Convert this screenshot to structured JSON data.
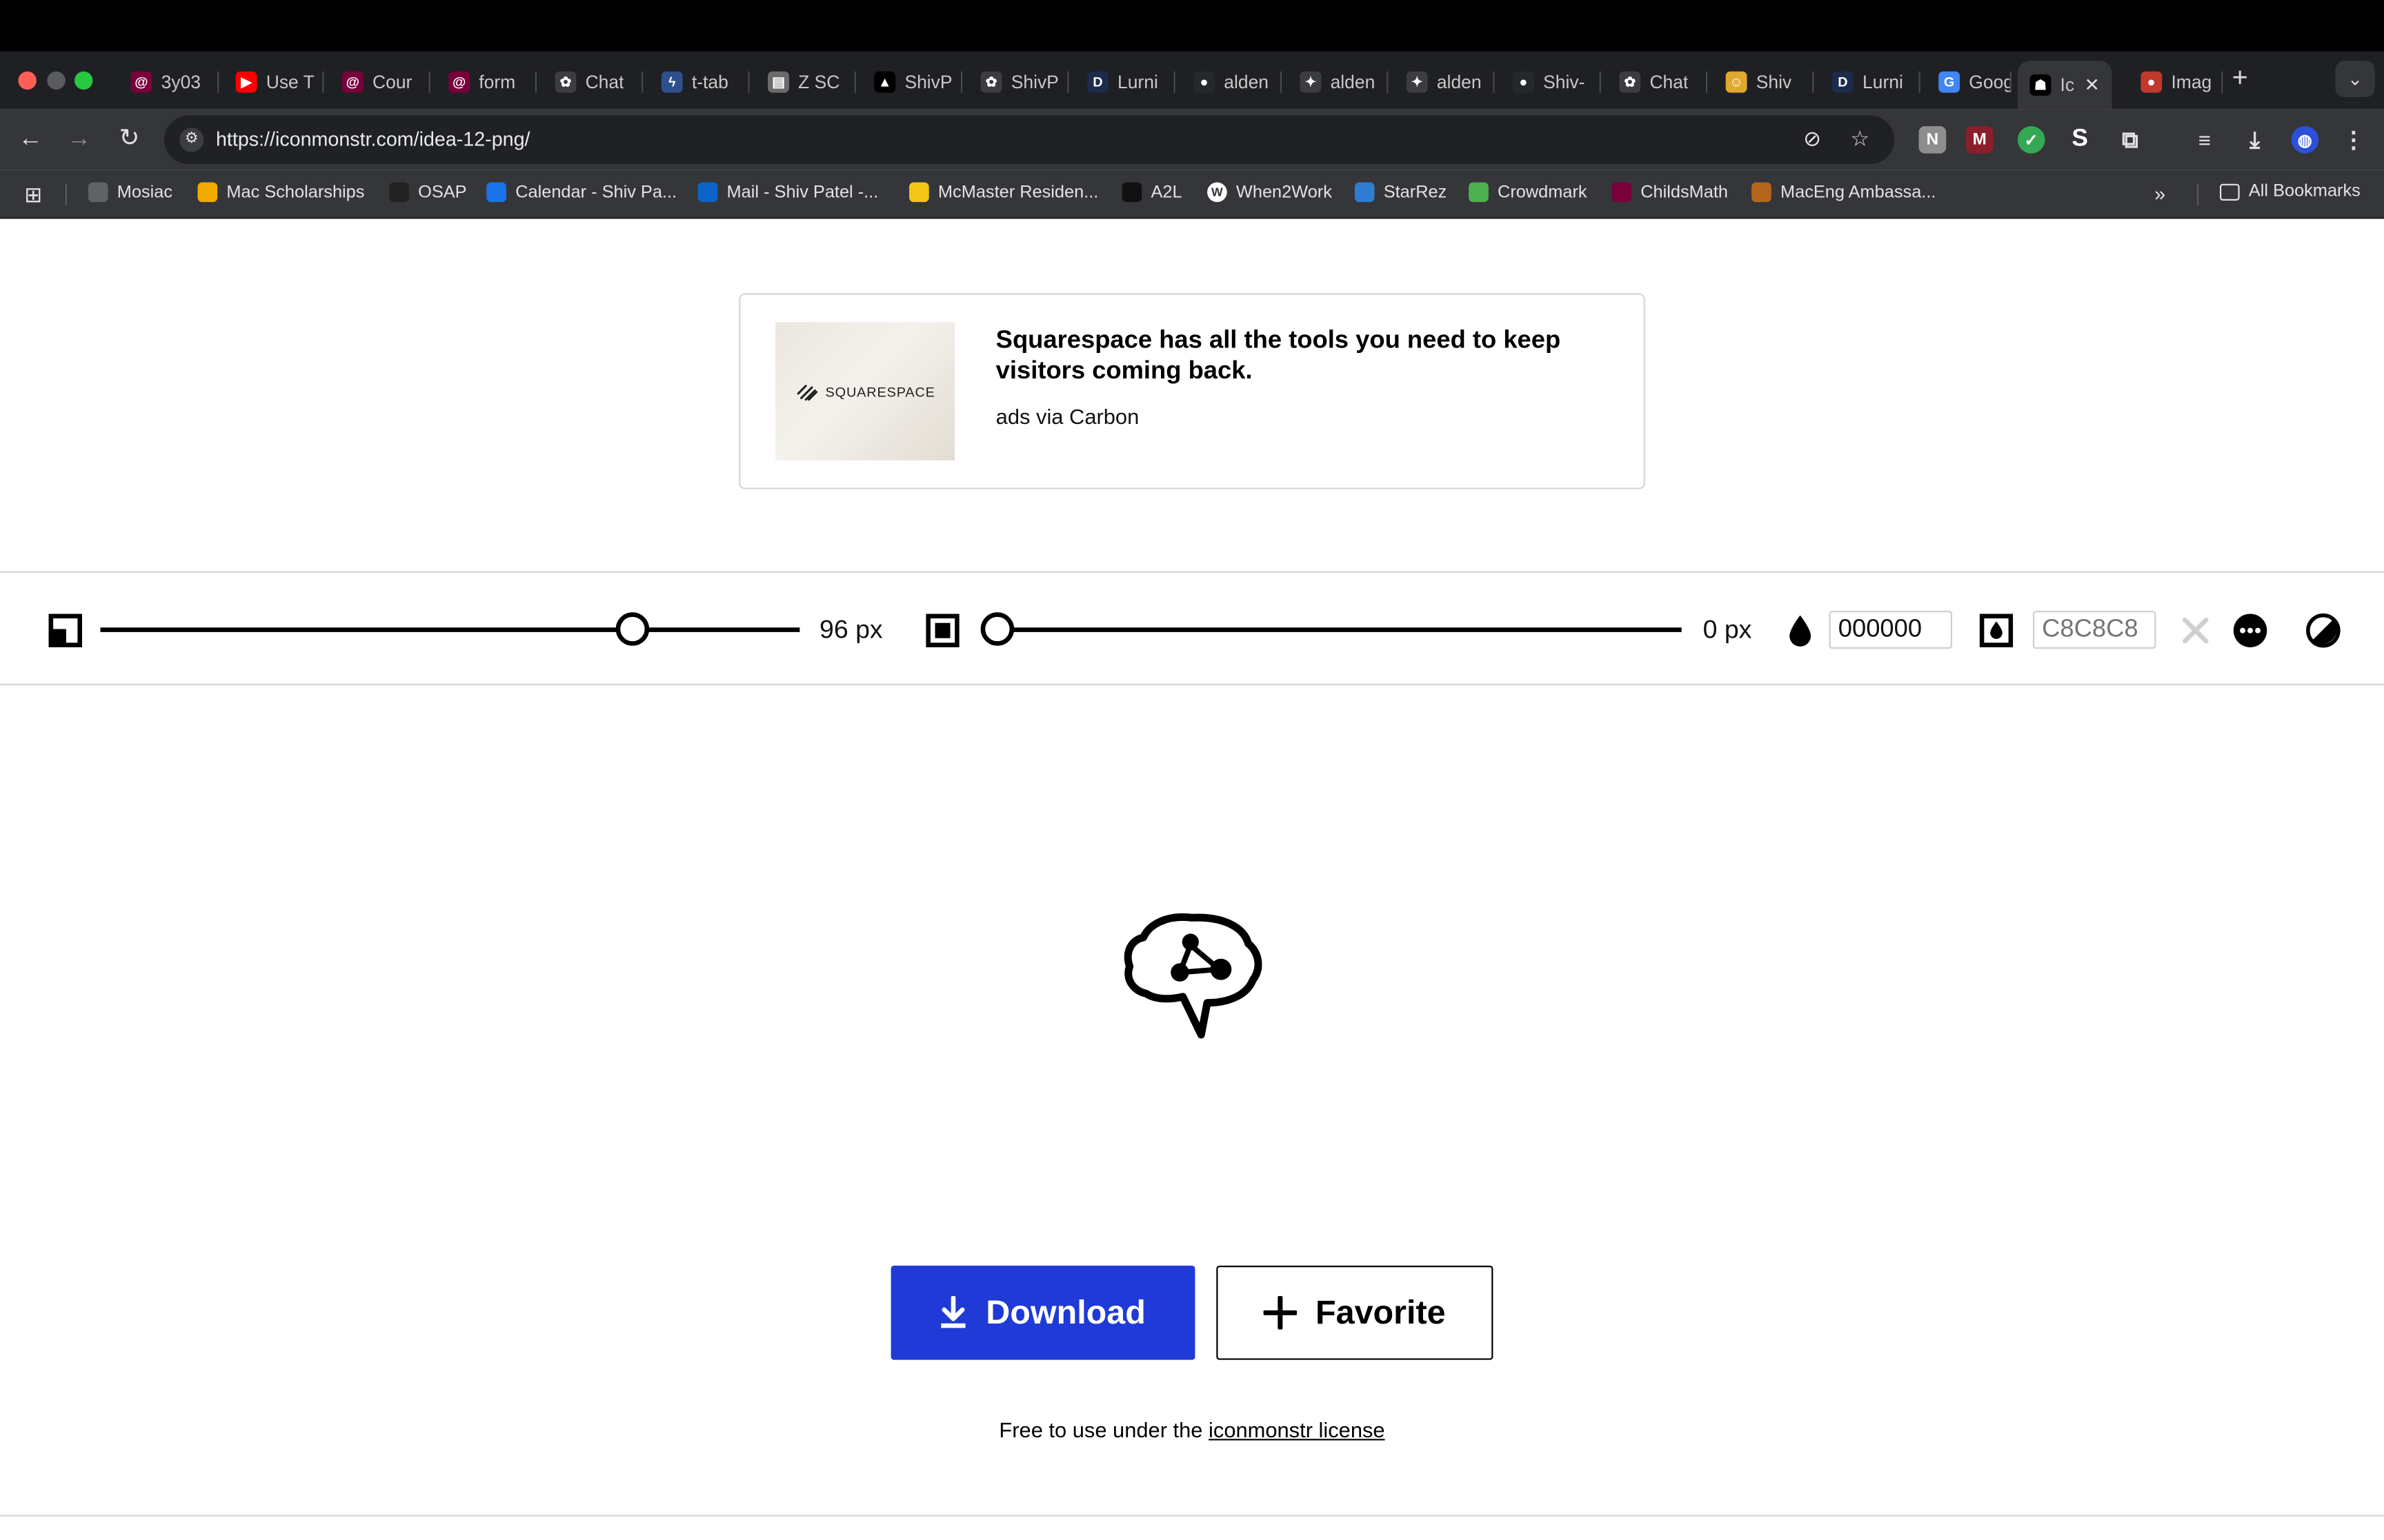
{
  "browser": {
    "tabs": [
      {
        "label": "3y03",
        "favicon": "mcmaster-icon",
        "color": "#7a003c",
        "glyph": "@"
      },
      {
        "label": "Use T",
        "favicon": "youtube-icon",
        "color": "#ff0000",
        "glyph": "▶"
      },
      {
        "label": "Cour",
        "favicon": "mcmaster-icon",
        "color": "#7a003c",
        "glyph": "@"
      },
      {
        "label": "form",
        "favicon": "mcmaster-icon",
        "color": "#7a003c",
        "glyph": "@"
      },
      {
        "label": "Chat",
        "favicon": "openai-icon",
        "color": "#3c3d41",
        "glyph": "✿"
      },
      {
        "label": "t-tab",
        "favicon": "pytorch-icon",
        "color": "#2d4f8c",
        "glyph": "ϟ"
      },
      {
        "label": "Z SC",
        "favicon": "document-icon",
        "color": "#6b6b6b",
        "glyph": "▤"
      },
      {
        "label": "ShivP",
        "favicon": "vercel-icon",
        "color": "#000000",
        "glyph": "▲"
      },
      {
        "label": "ShivP",
        "favicon": "openai-icon",
        "color": "#3c3d41",
        "glyph": "✿"
      },
      {
        "label": "Lurni",
        "favicon": "d-icon",
        "color": "#1c2b4a",
        "glyph": "D"
      },
      {
        "label": "alden",
        "favicon": "github-icon",
        "color": "#24292e",
        "glyph": "●"
      },
      {
        "label": "alden",
        "favicon": "sparkle-icon",
        "color": "#3c3d41",
        "glyph": "✦"
      },
      {
        "label": "alden",
        "favicon": "sparkle-icon",
        "color": "#3c3d41",
        "glyph": "✦"
      },
      {
        "label": "Shiv-",
        "favicon": "github-icon",
        "color": "#24292e",
        "glyph": "●"
      },
      {
        "label": "Chat",
        "favicon": "openai-icon",
        "color": "#3c3d41",
        "glyph": "✿"
      },
      {
        "label": "Shiv",
        "favicon": "emoji-icon",
        "color": "#e0a82e",
        "glyph": "☺"
      },
      {
        "label": "Lurni",
        "favicon": "d-icon",
        "color": "#1c2b4a",
        "glyph": "D"
      },
      {
        "label": "Goog",
        "favicon": "google-icon",
        "color": "#4285f4",
        "glyph": "G"
      },
      {
        "label": "Ic",
        "favicon": "iconmonstr-icon",
        "color": "#000000",
        "glyph": "☗"
      },
      {
        "label": "Imag",
        "favicon": "avatar-icon",
        "color": "#c0392b",
        "glyph": "●"
      }
    ],
    "url": "https://iconmonstr.com/idea-12-png/",
    "bookmarks": [
      {
        "label": "Mosiac",
        "icon": "globe-icon",
        "color": "#5f6368"
      },
      {
        "label": "Mac Scholarships",
        "icon": "triangle-icon",
        "color": "#f2a900"
      },
      {
        "label": "OSAP",
        "icon": "shield-icon",
        "color": "#222222"
      },
      {
        "label": "Calendar - Shiv Pa...",
        "icon": "calendar-icon",
        "color": "#1a73e8"
      },
      {
        "label": "Mail - Shiv Patel -...",
        "icon": "outlook-icon",
        "color": "#0a64c8"
      },
      {
        "label": "McMaster Residen...",
        "icon": "star-icon",
        "color": "#f5c518"
      },
      {
        "label": "A2L",
        "icon": "d2l-icon",
        "color": "#111111"
      },
      {
        "label": "When2Work",
        "icon": "w-icon",
        "color": "#ffffff"
      },
      {
        "label": "StarRez",
        "icon": "star-icon",
        "color": "#2e7dd1"
      },
      {
        "label": "Crowdmark",
        "icon": "crowdmark-icon",
        "color": "#4caf50"
      },
      {
        "label": "ChildsMath",
        "icon": "mcmaster-icon",
        "color": "#7a003c"
      },
      {
        "label": "MacEng Ambassa...",
        "icon": "maceng-icon",
        "color": "#b5651d"
      }
    ],
    "all_bookmarks": "All Bookmarks"
  },
  "ad": {
    "logo_text": "SQUARESPACE",
    "title": "Squarespace has all the tools you need to keep visitors coming back.",
    "via": "ads via Carbon"
  },
  "controls": {
    "size_value": "96 px",
    "size_fraction": 0.76,
    "padding_value": "0 px",
    "padding_fraction": 0.0,
    "color_value": "000000",
    "background_placeholder": "C8C8C8"
  },
  "actions": {
    "download_label": "Download",
    "favorite_label": "Favorite"
  },
  "license": {
    "prefix": "Free to use under the ",
    "link": "iconmonstr license"
  }
}
